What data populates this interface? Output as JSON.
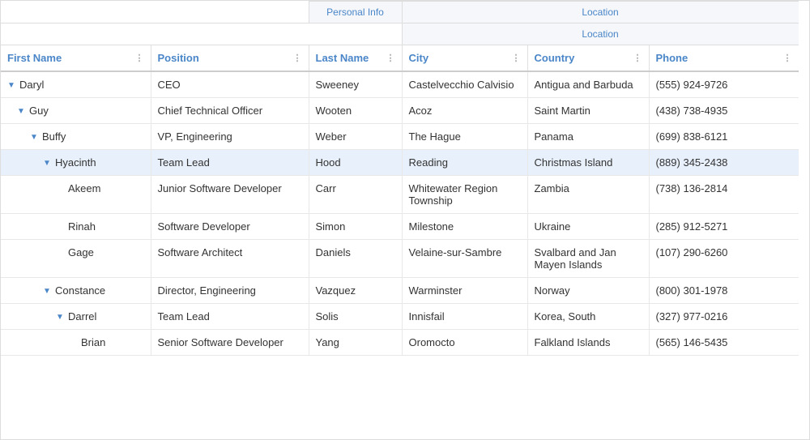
{
  "columns": {
    "firstName": "First Name",
    "position": "Position",
    "lastName": "Last Name",
    "city": "City",
    "country": "Country",
    "phone": "Phone"
  },
  "groupHeaders": {
    "personalInfo": "Personal Info",
    "location": "Location"
  },
  "rows": [
    {
      "id": "daryl",
      "firstName": "Daryl",
      "indent": 0,
      "expandable": true,
      "expanded": true,
      "position": "CEO",
      "lastName": "Sweeney",
      "city": "Castelvecchio Calvisio",
      "country": "Antigua and Barbuda",
      "phone": "(555) 924-9726",
      "highlighted": false
    },
    {
      "id": "guy",
      "firstName": "Guy",
      "indent": 1,
      "expandable": true,
      "expanded": true,
      "position": "Chief Technical Officer",
      "lastName": "Wooten",
      "city": "Acoz",
      "country": "Saint Martin",
      "phone": "(438) 738-4935",
      "highlighted": false
    },
    {
      "id": "buffy",
      "firstName": "Buffy",
      "indent": 2,
      "expandable": true,
      "expanded": true,
      "position": "VP, Engineering",
      "lastName": "Weber",
      "city": "The Hague",
      "country": "Panama",
      "phone": "(699) 838-6121",
      "highlighted": false
    },
    {
      "id": "hyacinth",
      "firstName": "Hyacinth",
      "indent": 3,
      "expandable": true,
      "expanded": true,
      "position": "Team Lead",
      "lastName": "Hood",
      "city": "Reading",
      "country": "Christmas Island",
      "phone": "(889) 345-2438",
      "highlighted": true
    },
    {
      "id": "akeem",
      "firstName": "Akeem",
      "indent": 4,
      "expandable": false,
      "expanded": false,
      "position": "Junior Software Developer",
      "lastName": "Carr",
      "city": "Whitewater Region Township",
      "country": "Zambia",
      "phone": "(738) 136-2814",
      "highlighted": false
    },
    {
      "id": "rinah",
      "firstName": "Rinah",
      "indent": 4,
      "expandable": false,
      "expanded": false,
      "position": "Software Developer",
      "lastName": "Simon",
      "city": "Milestone",
      "country": "Ukraine",
      "phone": "(285) 912-5271",
      "highlighted": false
    },
    {
      "id": "gage",
      "firstName": "Gage",
      "indent": 4,
      "expandable": false,
      "expanded": false,
      "position": "Software Architect",
      "lastName": "Daniels",
      "city": "Velaine-sur-Sambre",
      "country": "Svalbard and Jan Mayen Islands",
      "phone": "(107) 290-6260",
      "highlighted": false
    },
    {
      "id": "constance",
      "firstName": "Constance",
      "indent": 3,
      "expandable": true,
      "expanded": true,
      "position": "Director, Engineering",
      "lastName": "Vazquez",
      "city": "Warminster",
      "country": "Norway",
      "phone": "(800) 301-1978",
      "highlighted": false
    },
    {
      "id": "darrel",
      "firstName": "Darrel",
      "indent": 4,
      "expandable": true,
      "expanded": true,
      "position": "Team Lead",
      "lastName": "Solis",
      "city": "Innisfail",
      "country": "Korea, South",
      "phone": "(327) 977-0216",
      "highlighted": false
    },
    {
      "id": "brian",
      "firstName": "Brian",
      "indent": 5,
      "expandable": false,
      "expanded": false,
      "position": "Senior Software Developer",
      "lastName": "Yang",
      "city": "Oromocto",
      "country": "Falkland Islands",
      "phone": "(565) 146-5435",
      "highlighted": false
    }
  ]
}
